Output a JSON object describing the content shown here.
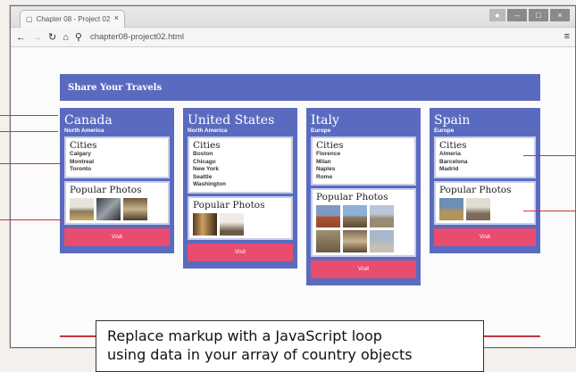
{
  "browser": {
    "tab_title": "Chapter 08 - Project 02",
    "tab_close": "×",
    "url": "chapter08-project02.html",
    "controls": {
      "minimize": "–",
      "maximize": "□",
      "close": "×"
    }
  },
  "app": {
    "header_title": "Share Your Travels",
    "countries": [
      {
        "name": "Canada",
        "continent": "North America",
        "cities_heading": "Cities",
        "cities": [
          "Calgary",
          "Montreal",
          "Toronto"
        ],
        "photos_heading": "Popular Photos",
        "photo_count": 3,
        "visit_label": "Visit"
      },
      {
        "name": "United States",
        "continent": "North America",
        "cities_heading": "Cities",
        "cities": [
          "Boston",
          "Chicago",
          "New York",
          "Seattle",
          "Washington"
        ],
        "photos_heading": "Popular Photos",
        "photo_count": 2,
        "visit_label": "Visit"
      },
      {
        "name": "Italy",
        "continent": "Europe",
        "cities_heading": "Cities",
        "cities": [
          "Florence",
          "Milan",
          "Naples",
          "Rome"
        ],
        "photos_heading": "Popular Photos",
        "photo_count": 6,
        "visit_label": "Visit"
      },
      {
        "name": "Spain",
        "continent": "Europe",
        "cities_heading": "Cities",
        "cities": [
          "Almeria",
          "Barcelona",
          "Madrid"
        ],
        "photos_heading": "Popular Photos",
        "photo_count": 2,
        "visit_label": "Visit"
      }
    ]
  },
  "caption": {
    "line1": "Replace markup with a JavaScript loop",
    "line2": "using data in your array of country objects"
  },
  "colors": {
    "header_bg": "#5a6bbf",
    "visit_button": "#e84c6e",
    "callout_line": "#c4353a"
  }
}
